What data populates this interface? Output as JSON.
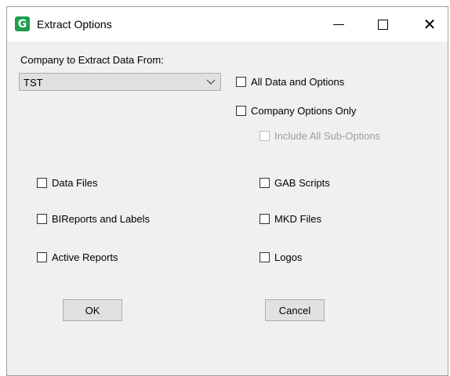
{
  "window": {
    "title": "Extract Options",
    "icon_letter": "G",
    "icon_color": "#1e9e4a",
    "controls": [
      "minimize-icon",
      "maximize-icon",
      "close-icon"
    ],
    "close_glyph": "✕"
  },
  "company": {
    "label": "Company to Extract Data From:",
    "selected": "TST"
  },
  "options": {
    "all_data": {
      "label": "All Data and Options",
      "checked": false
    },
    "company_only": {
      "label": "Company Options Only",
      "checked": false
    },
    "sub_options": {
      "label": "Include All Sub-Options",
      "checked": false,
      "disabled": true
    }
  },
  "files": {
    "data_files": "Data Files",
    "bi_reports": "BIReports and Labels",
    "active_reports": "Active Reports",
    "gab_scripts": "GAB Scripts",
    "mkd_files": "MKD Files",
    "logos": "Logos"
  },
  "buttons": {
    "ok": "OK",
    "cancel": "Cancel"
  }
}
